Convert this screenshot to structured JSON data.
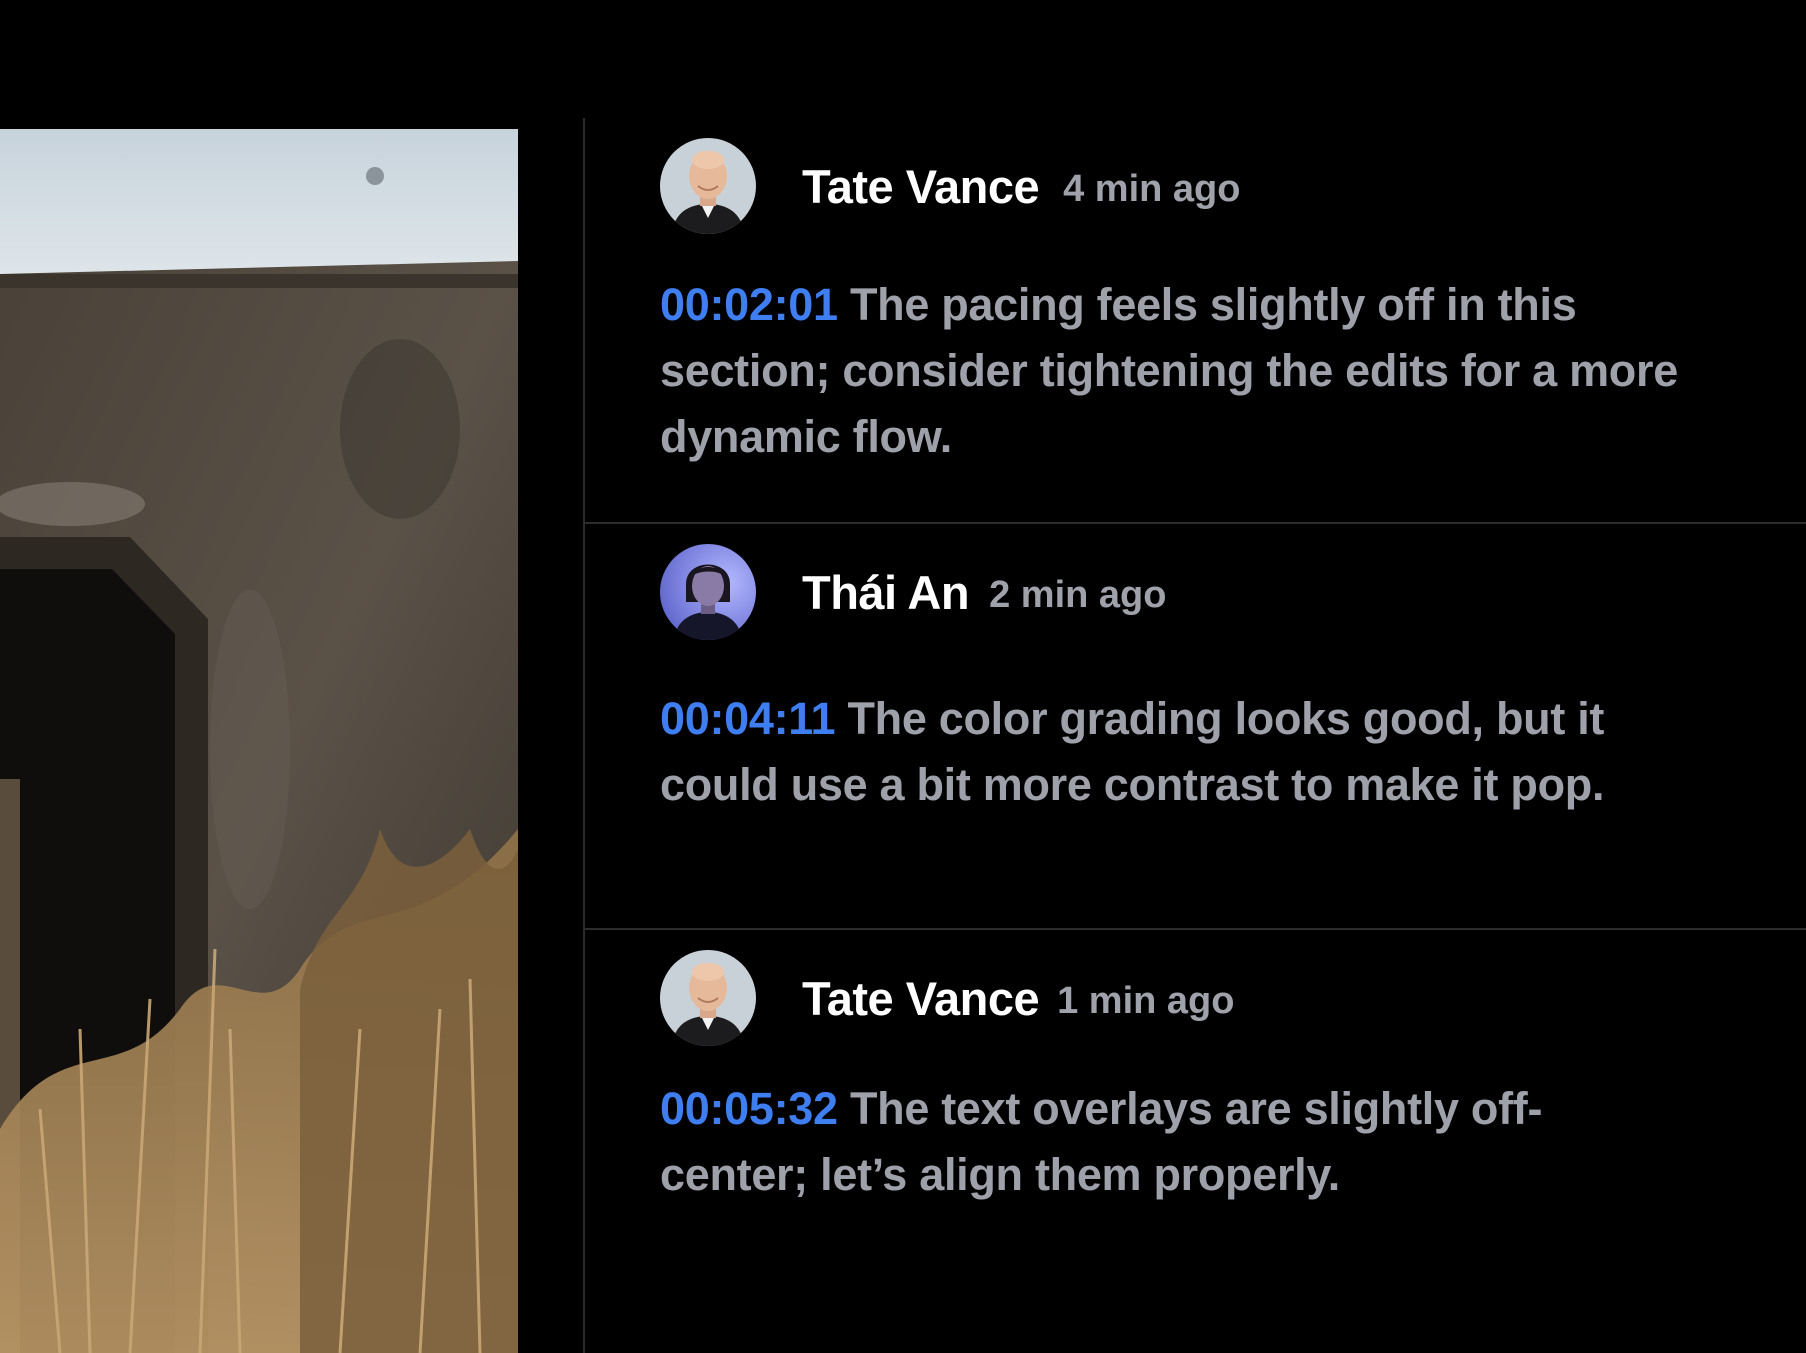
{
  "colors": {
    "background": "#000000",
    "divider": "#2c2c2e",
    "author": "#ffffff",
    "meta": "#a0a2ab",
    "body_text": "#9fa1aa",
    "timestamp_link": "#3f7ef0"
  },
  "video_preview": {
    "icon": "concrete-tunnel-with-dry-grass-image"
  },
  "comments": [
    {
      "avatar": "bald-man-avatar",
      "author": "Tate Vance",
      "time_ago": "4 min ago",
      "timestamp": "00:02:01",
      "text": "The pacing feels slightly off in this section; consider tightening the edits for a more dynamic flow."
    },
    {
      "avatar": "woman-avatar",
      "author": "Thái An",
      "time_ago": "2 min ago",
      "timestamp": "00:04:11",
      "text": "The color grading looks good, but it could use a bit more contrast to make it pop."
    },
    {
      "avatar": "bald-man-avatar",
      "author": "Tate Vance",
      "time_ago": "1 min ago",
      "timestamp": "00:05:32",
      "text": "The text overlays are slightly off-center; let’s align them properly."
    }
  ]
}
